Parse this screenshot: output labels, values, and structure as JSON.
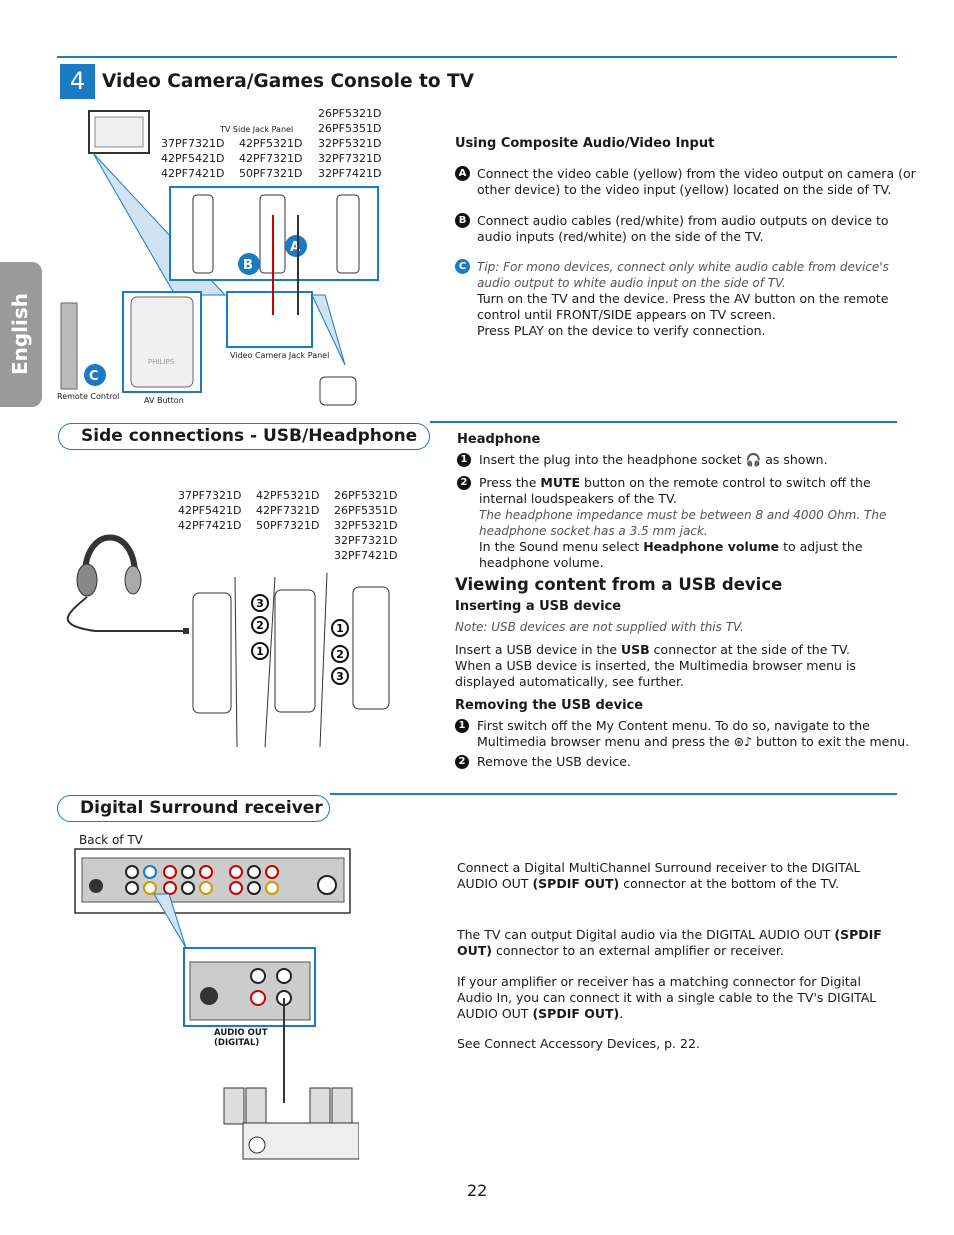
{
  "side_tab": "English",
  "section1": {
    "number": "4",
    "title": "Video Camera/Games Console to TV",
    "diagram": {
      "panel_label": "TV Side Jack Panel",
      "models_col1": [
        "37PF7321D",
        "42PF5421D",
        "42PF7421D"
      ],
      "models_col2": [
        "42PF5321D",
        "42PF7321D",
        "50PF7321D"
      ],
      "models_col3": [
        "26PF5321D",
        "26PF5351D",
        "32PF5321D",
        "32PF7321D",
        "32PF7421D"
      ],
      "remote_label": "Remote Control",
      "av_label": "AV Button",
      "camera_label": "Video Camera Jack Panel",
      "brand": "PHILIPS"
    },
    "heading": "Using Composite Audio/Video Input",
    "steps": [
      {
        "badge": "A",
        "text": "Connect the video cable (yellow) from the video output on camera (or other device) to the video input (yellow) located on the side of TV."
      },
      {
        "badge": "B",
        "text": "Connect audio cables (red/white) from audio outputs on device to audio inputs (red/white) on the side of the TV."
      }
    ],
    "step_c": {
      "badge": "C",
      "tip": "Tip: For mono devices, connect only white audio cable from device's audio output to white audio input on the side of TV.",
      "text1": "Turn on the TV and the device. Press the AV button on the remote control until FRONT/SIDE appears on TV screen.",
      "text2": "Press PLAY on the device to verify connection."
    }
  },
  "section2": {
    "title": "Side connections - USB/Headphone",
    "diagram": {
      "models_col1": [
        "37PF7321D",
        "42PF5421D",
        "42PF7421D"
      ],
      "models_col2": [
        "42PF5321D",
        "42PF7321D",
        "50PF7321D"
      ],
      "models_col3": [
        "26PF5321D",
        "26PF5351D",
        "32PF5321D",
        "32PF7321D",
        "32PF7421D"
      ]
    },
    "headphone": {
      "heading": "Headphone",
      "step1_a": "Insert the plug into the headphone socket",
      "step1_b": "as shown.",
      "step2_a": "Press the",
      "step2_bold": "MUTE",
      "step2_b": "button on the remote control to switch off the internal loudspeakers of the TV.",
      "note": "The headphone impedance must be between 8 and 4000 Ohm. The headphone socket has a 3.5 mm jack.",
      "step2_c": "In the Sound menu select",
      "step2_c_bold": "Headphone volume",
      "step2_d": "to adjust the headphone volume."
    },
    "usb": {
      "heading": "Viewing content from a USB device",
      "insert_heading": "Inserting a USB device",
      "note": "Note: USB devices are not supplied with this TV.",
      "insert_a": "Insert a USB device in the",
      "insert_bold": "USB",
      "insert_b": "connector at the side of the TV.",
      "insert_c": "When a USB device is inserted, the Multimedia browser menu is displayed automatically, see further.",
      "remove_heading": "Removing the USB device",
      "remove1_a": "First switch off the My Content menu. To do so, navigate to the Multimedia browser menu and press the",
      "remove1_b": "button to exit the menu.",
      "remove2": "Remove the USB device."
    }
  },
  "section3": {
    "title": "Digital Surround receiver",
    "back_label": "Back of TV",
    "audio_out_label": "AUDIO OUT (DIGITAL)",
    "p1_a": "Connect a Digital MultiChannel Surround receiver to the DIGITAL AUDIO OUT",
    "p1_bold": "(SPDIF OUT)",
    "p1_b": "connector at the bottom of the TV.",
    "p2_a": "The TV can output Digital audio via the DIGITAL AUDIO OUT",
    "p2_bold": "(SPDIF OUT)",
    "p2_b": "connector to an external amplifier or receiver.",
    "p3_a": "If your amplifier or receiver has a matching connector for Digital Audio In, you can connect it with a single cable to the TV's DIGITAL AUDIO OUT",
    "p3_bold": "(SPDIF OUT)",
    "p3_b": ".",
    "p4": "See Connect Accessory Devices, p. 22."
  },
  "page_number": "22",
  "colors": {
    "accent": "#1a7ac4",
    "tab": "#9a9a9a"
  }
}
